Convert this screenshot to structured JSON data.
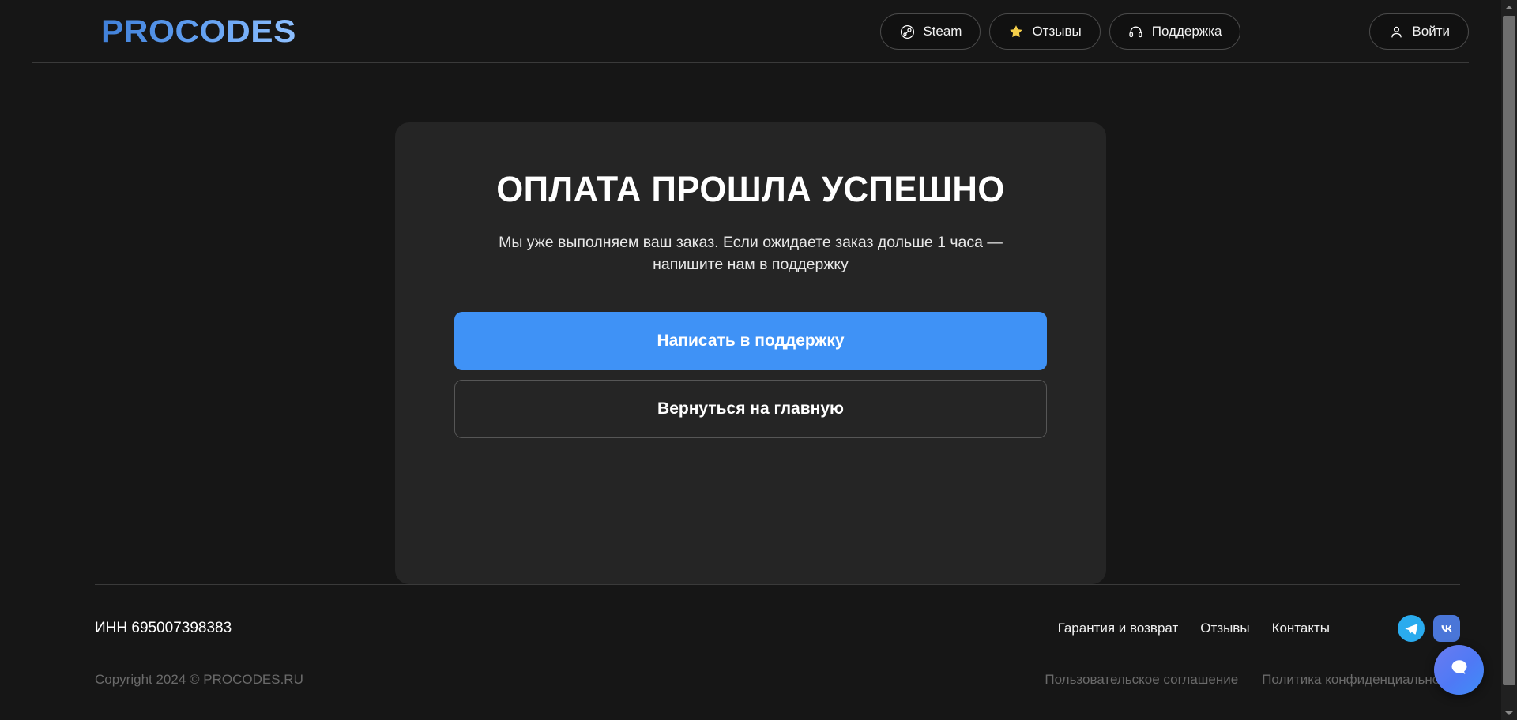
{
  "header": {
    "logo": "PROCODES",
    "nav": [
      {
        "label": "Steam",
        "icon": "steam-icon"
      },
      {
        "label": "Отзывы",
        "icon": "star-icon"
      },
      {
        "label": "Поддержка",
        "icon": "headset-icon"
      }
    ],
    "login": {
      "label": "Войти",
      "icon": "user-icon"
    }
  },
  "main": {
    "title": "ОПЛАТА ПРОШЛА УСПЕШНО",
    "description": "Мы уже выполняем ваш заказ. Если ожидаете заказ дольше 1 часа — напишите нам в поддержку",
    "primary_button": "Написать в поддержку",
    "secondary_button": "Вернуться на главную"
  },
  "footer": {
    "inn": "ИНН 695007398383",
    "copyright": "Copyright 2024 © PROCODES.RU",
    "links": [
      "Гарантия и возврат",
      "Отзывы",
      "Контакты"
    ],
    "legal_links": [
      "Пользовательское соглашение",
      "Политика конфиденциальности"
    ],
    "socials": [
      {
        "name": "telegram-icon",
        "label": "Telegram"
      },
      {
        "name": "vk-icon",
        "label": "VK"
      }
    ]
  },
  "chat": {
    "icon": "chat-bubble-icon",
    "label": "Чат поддержки"
  },
  "scrollbar": {
    "up": "▲",
    "down": "▼"
  },
  "colors": {
    "page_bg": "#161616",
    "card_bg": "#252525",
    "accent_blue": "#3f92f6",
    "logo_blue": "#5e9df0",
    "star_yellow": "#f5cf4a",
    "telegram_blue": "#2aabee",
    "vk_blue": "#4a76d8"
  }
}
